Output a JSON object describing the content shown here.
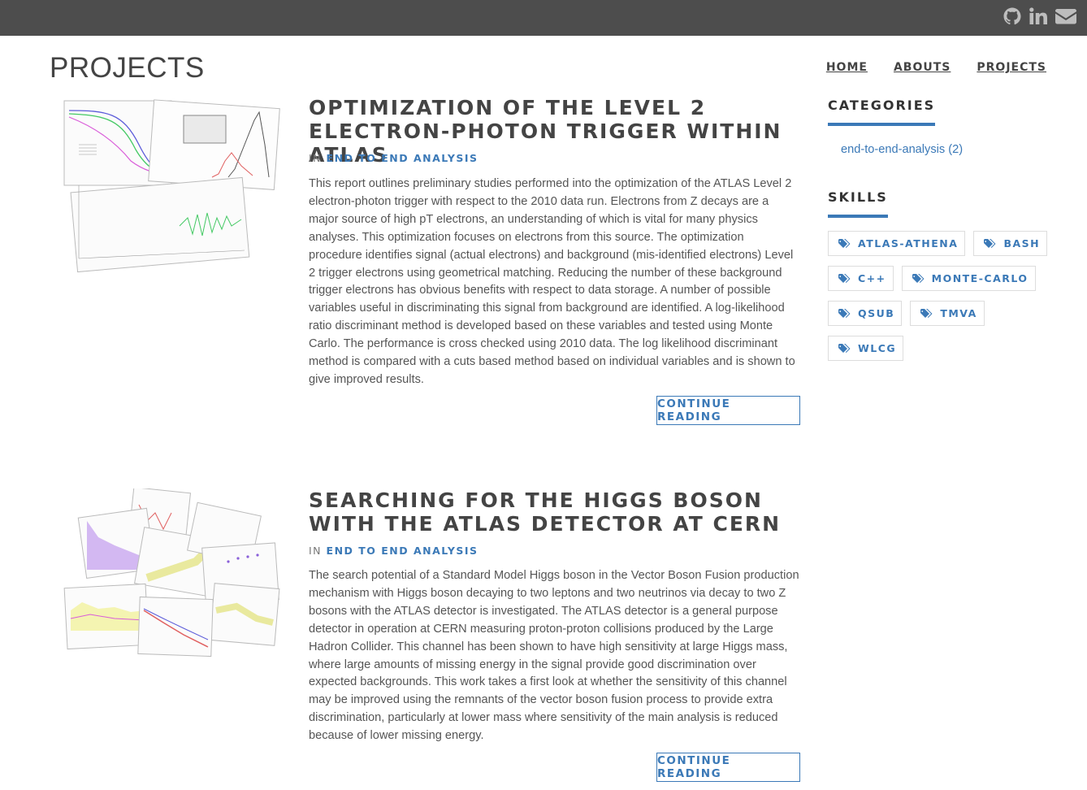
{
  "header": {
    "social_icons": [
      "github-icon",
      "linkedin-icon",
      "envelope-icon"
    ]
  },
  "page": {
    "title": "PROJECTS"
  },
  "nav": {
    "items": [
      {
        "label": "HOME"
      },
      {
        "label": "ABOUTS"
      },
      {
        "label": "PROJECTS"
      }
    ]
  },
  "posts": [
    {
      "title": "OPTIMIZATION OF THE LEVEL 2 ELECTRON-PHOTON TRIGGER WITHIN ATLAS",
      "meta_prefix": "IN",
      "category": "END TO END ANALYSIS",
      "body": "This report outlines preliminary studies performed into the optimization of the ATLAS Level 2 electron-photon trigger with respect to the 2010 data run. Electrons from Z decays are a major source of high pT electrons, an understanding of which is vital for many physics analyses. This optimization focuses on electrons from this source. The optimization procedure identifies signal (actual electrons) and background (mis-identified electrons) Level 2 trigger electrons using geometrical matching. Reducing the number of these background trigger electrons has obvious benefits with respect to data storage. A number of possible variables useful in discriminating this signal from background are identified. A log-likelihood ratio discriminant method is developed based on these variables and tested using Monte Carlo. The performance is cross checked using 2010 data. The log likelihood discriminant method is compared with a cuts based method based on individual variables and is shown to give improved results.",
      "button": "CONTINUE READING"
    },
    {
      "title": "SEARCHING FOR THE HIGGS BOSON WITH THE ATLAS DETECTOR AT CERN",
      "meta_prefix": "IN",
      "category": "END TO END ANALYSIS",
      "body": "The search potential of a Standard Model Higgs boson in the Vector Boson Fusion production mechanism with Higgs boson decaying to two leptons and two neutrinos via decay to two Z bosons with the ATLAS detector is investigated. The ATLAS detector is a general purpose detector in operation at CERN measuring proton-proton collisions produced by the Large Hadron Collider. This channel has been shown to have high sensitivity at large Higgs mass, where large amounts of missing energy in the signal provide good discrimination over expected backgrounds. This work takes a first look at whether the sensitivity of this channel may be improved using the remnants of the vector boson fusion process to provide extra discrimination, particularly at lower mass where sensitivity of the main analysis is reduced because of lower missing energy.",
      "button": "CONTINUE READING"
    }
  ],
  "sidebar": {
    "categories_title": "CATEGORIES",
    "categories": [
      {
        "label": "end-to-end-analysis (2)"
      }
    ],
    "skills_title": "SKILLS",
    "skills": [
      {
        "label": "ATLAS-ATHENA"
      },
      {
        "label": "BASH"
      },
      {
        "label": "C++"
      },
      {
        "label": "MONTE-CARLO"
      },
      {
        "label": "QSUB"
      },
      {
        "label": "TMVA"
      },
      {
        "label": "WLCG"
      }
    ]
  },
  "colors": {
    "topbar": "#4d4d4d",
    "accent": "#3b79b7",
    "text": "#555555"
  }
}
